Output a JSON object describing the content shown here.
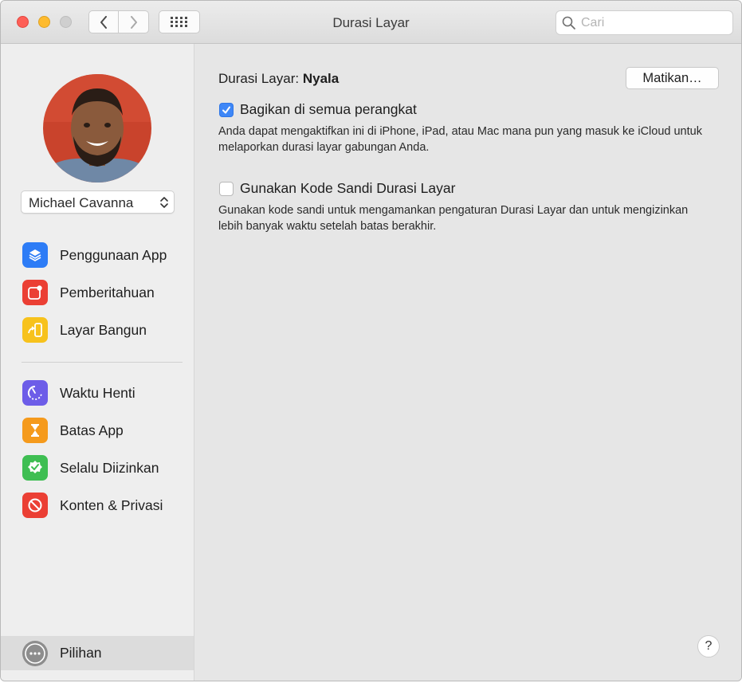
{
  "window": {
    "title": "Durasi Layar"
  },
  "search": {
    "placeholder": "Cari"
  },
  "user": {
    "name": "Michael Cavanna"
  },
  "sidebar": {
    "group1": [
      {
        "label": "Penggunaan App",
        "icon": "layers-icon",
        "color": "#2d7cf6"
      },
      {
        "label": "Pemberitahuan",
        "icon": "notification-icon",
        "color": "#eb3f34"
      },
      {
        "label": "Layar Bangun",
        "icon": "pickup-phone-icon",
        "color": "#f7c21c"
      }
    ],
    "group2": [
      {
        "label": "Waktu Henti",
        "icon": "downtime-icon",
        "color": "#6d5de8"
      },
      {
        "label": "Batas App",
        "icon": "hourglass-icon",
        "color": "#f59a1c"
      },
      {
        "label": "Selalu Diizinkan",
        "icon": "checkmark-badge-icon",
        "color": "#3ebe52"
      },
      {
        "label": "Konten & Privasi",
        "icon": "restriction-icon",
        "color": "#eb3f34"
      }
    ],
    "options": {
      "label": "Pilihan",
      "icon": "more-options-icon"
    }
  },
  "main": {
    "status_label": "Durasi Layar:",
    "status_value": "Nyala",
    "turn_off_button": "Matikan…",
    "share_checkbox": {
      "label": "Bagikan di semua perangkat",
      "checked": true,
      "description": "Anda dapat mengaktifkan ini di iPhone, iPad, atau Mac mana pun yang masuk ke iCloud untuk melaporkan durasi layar gabungan Anda."
    },
    "passcode_checkbox": {
      "label": "Gunakan Kode Sandi Durasi Layar",
      "checked": false,
      "description": "Gunakan kode sandi untuk mengamankan pengaturan Durasi Layar dan untuk mengizinkan lebih banyak waktu setelah batas berakhir."
    },
    "help_button": "?"
  }
}
